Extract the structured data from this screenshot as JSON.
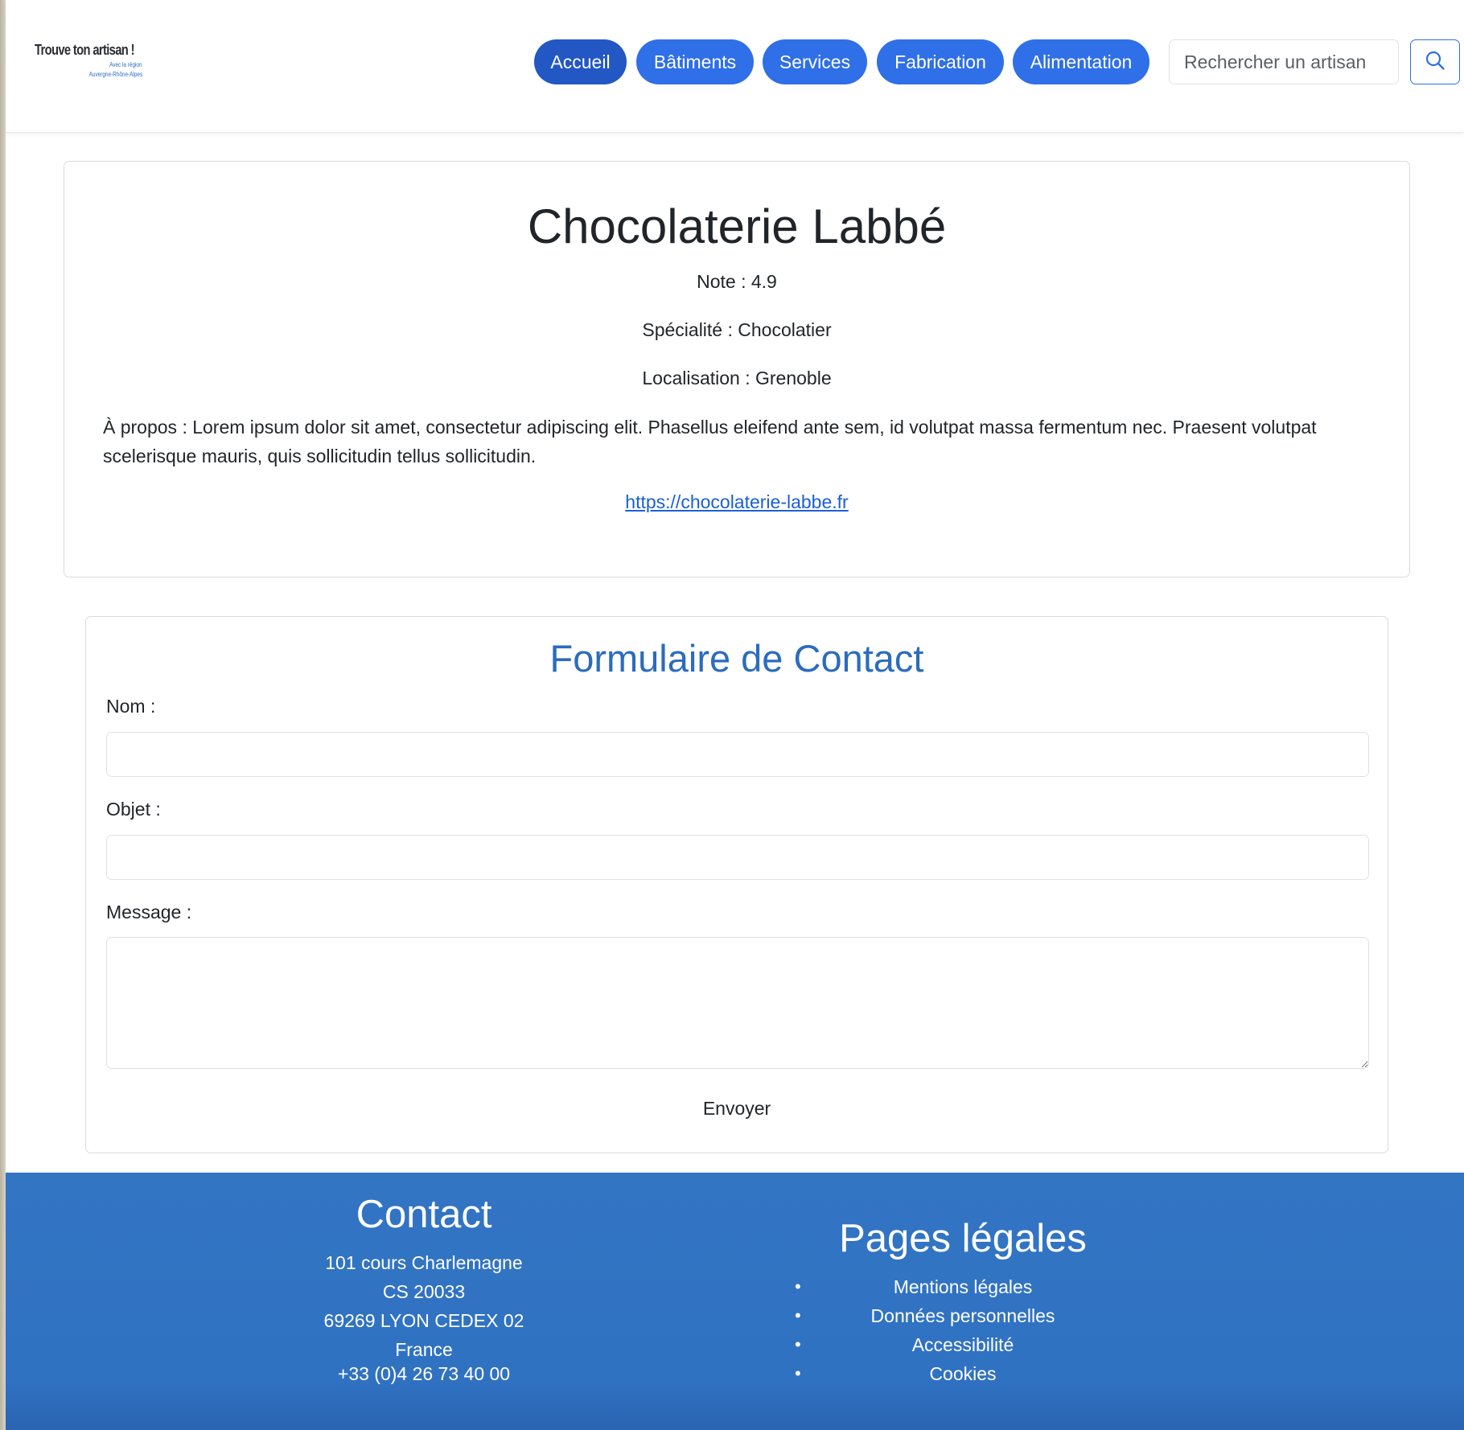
{
  "header": {
    "logo": {
      "title": "Trouve ton artisan !",
      "subtitle_line1": "Avec la région",
      "subtitle_line2": "Auvergne-Rhône-Alpes"
    },
    "nav": [
      {
        "label": "Accueil",
        "active": true
      },
      {
        "label": "Bâtiments",
        "active": false
      },
      {
        "label": "Services",
        "active": false
      },
      {
        "label": "Fabrication",
        "active": false
      },
      {
        "label": "Alimentation",
        "active": false
      }
    ],
    "search": {
      "placeholder": "Rechercher un artisan",
      "value": "",
      "icon": "search-icon"
    }
  },
  "artisan": {
    "name": "Chocolaterie Labbé",
    "note": "Note : 4.9",
    "specialite": "Spécialité : Chocolatier",
    "localisation": "Localisation : Grenoble",
    "about": "À propos : Lorem ipsum dolor sit amet, consectetur adipiscing elit. Phasellus eleifend ante sem, id volutpat massa fermentum nec. Praesent volutpat scelerisque mauris, quis sollicitudin tellus sollicitudin.",
    "website": "https://chocolaterie-labbe.fr"
  },
  "contact_form": {
    "title": "Formulaire de Contact",
    "nom_label": "Nom :",
    "nom_value": "",
    "objet_label": "Objet :",
    "objet_value": "",
    "message_label": "Message :",
    "message_value": "",
    "submit_label": "Envoyer"
  },
  "footer": {
    "contact": {
      "title": "Contact",
      "address_line1": "101 cours Charlemagne",
      "address_line2": "CS 20033",
      "address_line3": "69269 LYON CEDEX 02",
      "address_line4": "France",
      "phone": "+33 (0)4 26 73 40 00"
    },
    "legal": {
      "title": "Pages légales",
      "links": [
        {
          "label": "Mentions légales"
        },
        {
          "label": "Données personnelles"
        },
        {
          "label": "Accessibilité"
        },
        {
          "label": "Cookies"
        }
      ]
    }
  },
  "colors": {
    "primary": "#2f6fe7",
    "primary_active": "#2257c4",
    "form_title": "#2b6cbd",
    "footer_bg": "#3072c2",
    "link": "#1a5fd6"
  }
}
